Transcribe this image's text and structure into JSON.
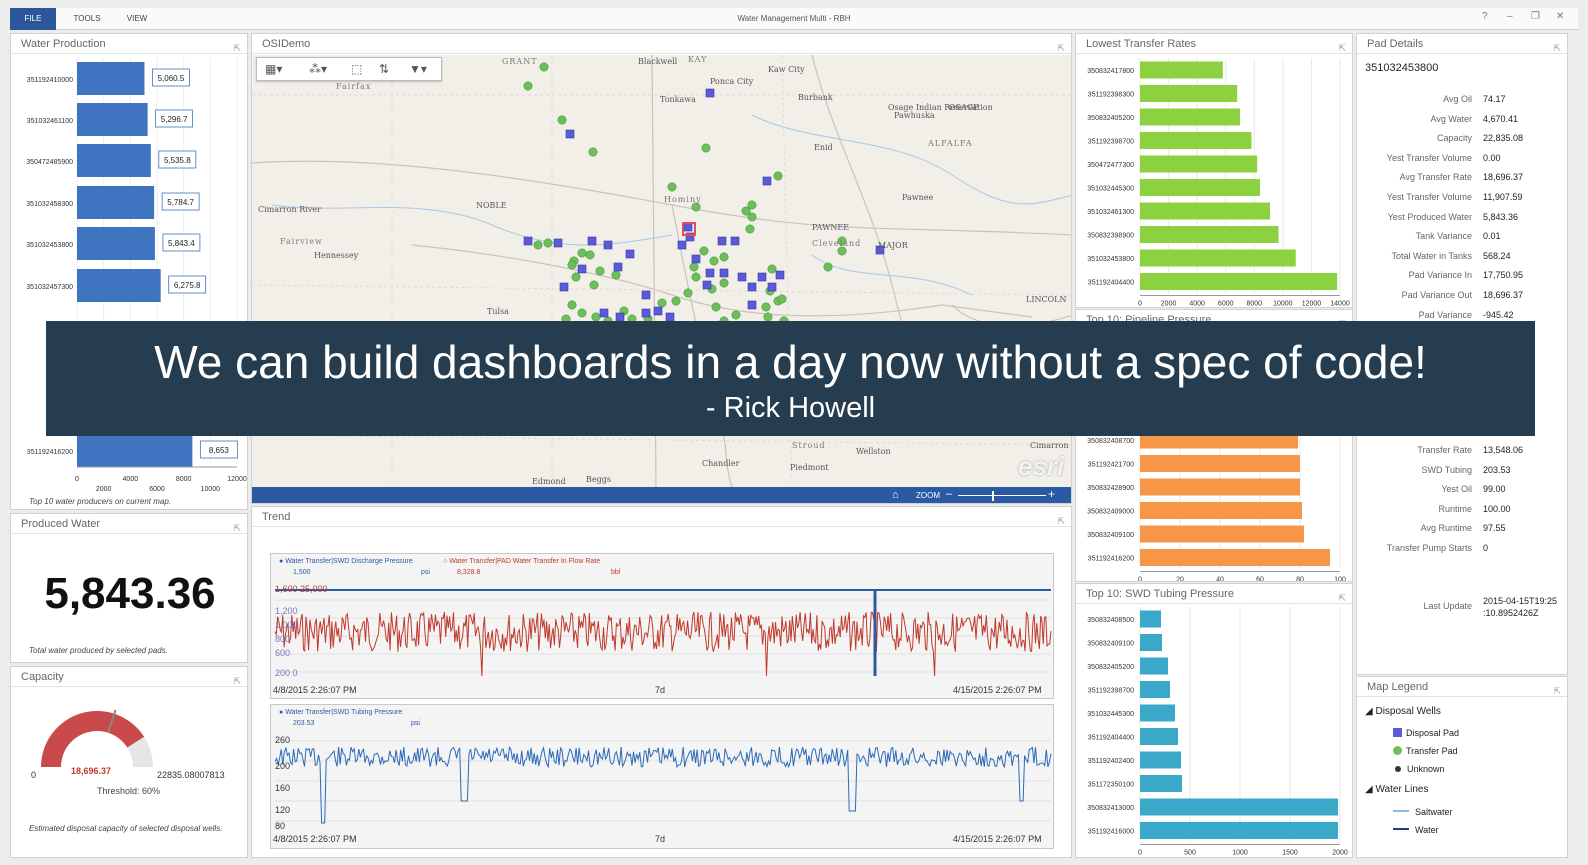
{
  "app": {
    "title": "Water Management Multi - RBH",
    "menu": [
      "FILE",
      "TOOLS",
      "VIEW"
    ],
    "controls": [
      "?",
      "–",
      "❐",
      "✕"
    ]
  },
  "water_production": {
    "title": "Water Production",
    "caption": "Top 10 water producers on current map.",
    "rows": [
      {
        "id": "351192410000",
        "value": 5060.5,
        "label": "5,060.5"
      },
      {
        "id": "351032461100",
        "value": 5296.7,
        "label": "5,296.7"
      },
      {
        "id": "350472485900",
        "value": 5535.8,
        "label": "5,535.8"
      },
      {
        "id": "351032458300",
        "value": 5784.7,
        "label": "5,784.7"
      },
      {
        "id": "351032453800",
        "value": 5843.4,
        "label": "5,843.4"
      },
      {
        "id": "351032457300",
        "value": 6275.8,
        "label": "6,275.8"
      },
      {
        "id": "351192416200",
        "value": 8653,
        "label": "8,653"
      }
    ],
    "xticks_top": [
      "0",
      "4000",
      "8000",
      "12000"
    ],
    "xticks_bottom": [
      "2000",
      "6000",
      "10000"
    ]
  },
  "produced_water": {
    "title": "Produced Water",
    "value": "5,843.36",
    "caption": "Total water produced by selected pads."
  },
  "capacity": {
    "title": "Capacity",
    "min": "0",
    "max": "22835.08007813",
    "value_label": "18,696.37",
    "fraction": 0.8188,
    "threshold": "Threshold: 60%",
    "caption": "Estimated disposal capacity of selected disposal wells."
  },
  "map": {
    "title": "OSIDemo",
    "labels": [
      "GRANT",
      "KAY",
      "Blackwell",
      "Kaw City",
      "Ponca City",
      "Tonkawa",
      "Burbank",
      "Osage Indian Reservation",
      "Pawhuska",
      "OSAGE",
      "ALFALFA",
      "Fairfax",
      "Enid",
      "NOBLE",
      "Hominy",
      "Pawnee",
      "PAWNEE",
      "Cleveland",
      "MAJOR",
      "Fairview",
      "Hennessey",
      "Tulsa",
      "LINCOLN",
      "Stroud",
      "Wellston",
      "Chandler",
      "Piedmont",
      "Edmond",
      "Beggs",
      "Cimarron River"
    ],
    "zoom_label": "ZOOM",
    "attribution": "esri"
  },
  "lowest_transfer": {
    "title": "Lowest Transfer Rates",
    "color": "#8cd13f",
    "rows": [
      {
        "id": "350832417800",
        "value": 5800
      },
      {
        "id": "351192398300",
        "value": 6800
      },
      {
        "id": "350832405200",
        "value": 7000
      },
      {
        "id": "351192398700",
        "value": 7800
      },
      {
        "id": "350472477300",
        "value": 8200
      },
      {
        "id": "351032445300",
        "value": 8400
      },
      {
        "id": "351032461300",
        "value": 9100
      },
      {
        "id": "350832398900",
        "value": 9700
      },
      {
        "id": "351032453800",
        "value": 10900
      },
      {
        "id": "351192404400",
        "value": 13800
      }
    ],
    "xticks": [
      "0",
      "2000",
      "4000",
      "6000",
      "8000",
      "10000",
      "12000",
      "14000"
    ]
  },
  "pipeline_pressure": {
    "title": "Top 10: Pipeline Pressure",
    "color": "#f79646",
    "rows": [
      {
        "id": "350832408700",
        "value": 79
      },
      {
        "id": "351192421700",
        "value": 80
      },
      {
        "id": "350832428900",
        "value": 80
      },
      {
        "id": "350832409000",
        "value": 81
      },
      {
        "id": "350832409100",
        "value": 82
      },
      {
        "id": "351192416200",
        "value": 95
      }
    ],
    "xticks": [
      "0",
      "20",
      "40",
      "60",
      "80",
      "100"
    ]
  },
  "swd_tubing": {
    "title": "Top 10: SWD Tubing Pressure",
    "color": "#3aa8c8",
    "rows": [
      {
        "id": "350832408500",
        "value": 210
      },
      {
        "id": "350832409100",
        "value": 220
      },
      {
        "id": "350832405200",
        "value": 280
      },
      {
        "id": "351192398700",
        "value": 300
      },
      {
        "id": "351032445300",
        "value": 350
      },
      {
        "id": "351192404400",
        "value": 380
      },
      {
        "id": "351192402400",
        "value": 410
      },
      {
        "id": "351172350100",
        "value": 420
      },
      {
        "id": "350832413000",
        "value": 1980
      },
      {
        "id": "351192416000",
        "value": 1980
      }
    ],
    "xticks": [
      "0",
      "500",
      "1000",
      "1500",
      "2000"
    ]
  },
  "pad_details": {
    "title": "Pad Details",
    "pad_id": "351032453800",
    "rows_top": [
      {
        "label": "Avg Oil",
        "value": "74.17"
      },
      {
        "label": "Avg Water",
        "value": "4,670.41"
      },
      {
        "label": "Capacity",
        "value": "22,835.08"
      },
      {
        "label": "Yest Transfer Volume",
        "value": "0.00"
      },
      {
        "label": "Avg Transfer Rate",
        "value": "18,696.37"
      },
      {
        "label": "Yest Transfer Volume",
        "value": "11,907.59"
      },
      {
        "label": "Yest Produced Water",
        "value": "5,843.36"
      },
      {
        "label": "Tank Variance",
        "value": "0.01"
      },
      {
        "label": "Total Water in Tanks",
        "value": "568.24"
      },
      {
        "label": "Pad Variance In",
        "value": "17,750.95"
      },
      {
        "label": "Pad Variance Out",
        "value": "18,696.37"
      },
      {
        "label": "Pad Variance",
        "value": "-945.42"
      }
    ],
    "rows_bottom": [
      {
        "label": "Transfer Rate",
        "value": "13,548.06"
      },
      {
        "label": "SWD Tubing",
        "value": "203.53"
      },
      {
        "label": "Yest Oil",
        "value": "99.00"
      },
      {
        "label": "Runtime",
        "value": "100.00"
      },
      {
        "label": "Avg Runtime",
        "value": "97.55"
      },
      {
        "label": "Transfer Pump Starts",
        "value": "0"
      }
    ],
    "last_update_label": "Last Update",
    "last_update_1": "2015-04-15T19:25",
    "last_update_2": ":10.8952426Z"
  },
  "map_legend": {
    "title": "Map Legend",
    "group1": "Disposal Wells",
    "items1": [
      "Disposal Pad",
      "Transfer Pad",
      "Unknown"
    ],
    "group2": "Water Lines",
    "items2": [
      "Saltwater",
      "Water"
    ],
    "colors": {
      "disposal": "#5b5bd8",
      "transfer": "#6dbf5b",
      "unknown": "#333333",
      "saltwater": "#8fb7e8",
      "water": "#1f3f8a"
    }
  },
  "trend": {
    "title": "Trend",
    "chart1": {
      "legend1": "Water Transfer|SWD Discharge Pressure",
      "legend1_value": "1,500",
      "legend1_unit": "psi",
      "legend2": "Water Transfer|PAD Water Transfer In Flow Rate",
      "legend2_value": "8,328.8",
      "legend2_unit": "bbl",
      "yticks": [
        "1,600 25,000",
        "1,200",
        "1,000",
        "800",
        "600",
        "200    0"
      ],
      "start": "4/8/2015 2:26:07 PM",
      "span": "7d",
      "end": "4/15/2015 2:26:07 PM"
    },
    "chart2": {
      "legend1": "Water Transfer|SWD Tubing Pressure",
      "legend1_value": "203.53",
      "legend1_unit": "psi",
      "yticks": [
        "260",
        "200",
        "160",
        "120",
        "80"
      ],
      "start": "4/8/2015 2:26:07 PM",
      "span": "7d",
      "end": "4/15/2015 2:26:07 PM"
    }
  },
  "quote": {
    "text": "We can build dashboards in a day now without a spec of code!",
    "author": "- Rick Howell"
  }
}
